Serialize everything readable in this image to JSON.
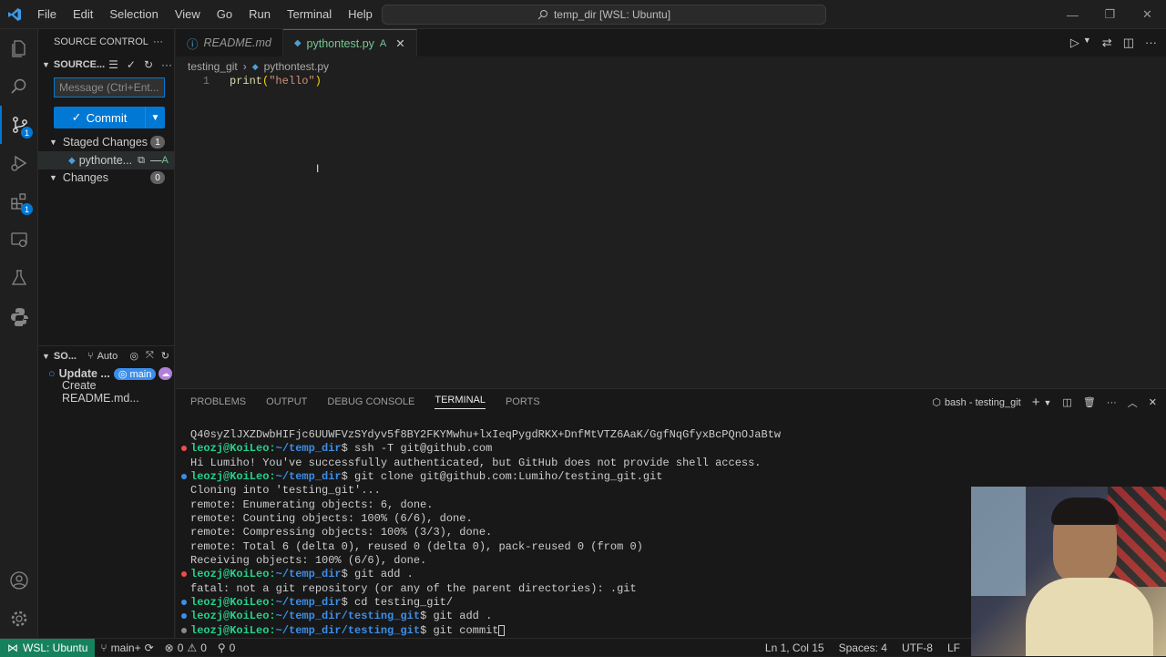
{
  "titlebar": {
    "menu": [
      "File",
      "Edit",
      "Selection",
      "View",
      "Go",
      "Run",
      "Terminal",
      "Help"
    ],
    "search": "temp_dir [WSL: Ubuntu]"
  },
  "activity": {
    "scm_badge": "1",
    "ext_badge": "1"
  },
  "sidebar": {
    "title": "SOURCE CONTROL",
    "section": "SOURCE...",
    "message_placeholder": "Message (Ctrl+Ent...",
    "commit_label": "Commit",
    "staged": {
      "label": "Staged Changes",
      "count": "1",
      "file": "pythonte...",
      "status": "A"
    },
    "changes": {
      "label": "Changes",
      "count": "0"
    },
    "graph": {
      "label": "SO...",
      "auto": "Auto",
      "items": [
        {
          "text": "Update ...",
          "branch": "main"
        },
        {
          "text": "Create README.md..."
        }
      ]
    }
  },
  "editor": {
    "tabs": [
      {
        "label": "README.md"
      },
      {
        "label": "pythontest.py",
        "status": "A"
      }
    ],
    "breadcrumb": [
      "testing_git",
      "pythontest.py"
    ],
    "lines": [
      {
        "num": "1",
        "code": "print(\"hello\")"
      }
    ]
  },
  "panel": {
    "tabs": [
      "PROBLEMS",
      "OUTPUT",
      "DEBUG CONSOLE",
      "TERMINAL",
      "PORTS"
    ],
    "terminal_name": "bash - testing_git"
  },
  "terminal": [
    {
      "type": "out",
      "text": "Q40syZlJXZDwbHIFjc6UUWFVzSYdyv5f8BY2FKYMwhu+lxIeqPygdRKX+DnfMtVTZ6AaK/GgfNqGfyxBcPQnOJaBtw"
    },
    {
      "type": "cmd",
      "dot": "#f14c4c",
      "user": "leozj@KoiLeo",
      "path": "~/temp_dir",
      "cmd": "ssh -T git@github.com"
    },
    {
      "type": "out",
      "text": "Hi Lumiho! You've successfully authenticated, but GitHub does not provide shell access."
    },
    {
      "type": "cmd",
      "dot": "#3b8eea",
      "user": "leozj@KoiLeo",
      "path": "~/temp_dir",
      "cmd": "git clone git@github.com:Lumiho/testing_git.git"
    },
    {
      "type": "out",
      "text": "Cloning into 'testing_git'..."
    },
    {
      "type": "out",
      "text": "remote: Enumerating objects: 6, done."
    },
    {
      "type": "out",
      "text": "remote: Counting objects: 100% (6/6), done."
    },
    {
      "type": "out",
      "text": "remote: Compressing objects: 100% (3/3), done."
    },
    {
      "type": "out",
      "text": "remote: Total 6 (delta 0), reused 0 (delta 0), pack-reused 0 (from 0)"
    },
    {
      "type": "out",
      "text": "Receiving objects: 100% (6/6), done."
    },
    {
      "type": "cmd",
      "dot": "#f14c4c",
      "user": "leozj@KoiLeo",
      "path": "~/temp_dir",
      "cmd": "git add ."
    },
    {
      "type": "out",
      "text": "fatal: not a git repository (or any of the parent directories): .git"
    },
    {
      "type": "cmd",
      "dot": "#3b8eea",
      "user": "leozj@KoiLeo",
      "path": "~/temp_dir",
      "cmd": "cd testing_git/"
    },
    {
      "type": "cmd",
      "dot": "#3b8eea",
      "user": "leozj@KoiLeo",
      "path": "~/temp_dir/testing_git",
      "cmd": "git add ."
    },
    {
      "type": "cmd",
      "dot": "#8b8b8b",
      "user": "leozj@KoiLeo",
      "path": "~/temp_dir/testing_git",
      "cmd": "git commit"
    }
  ],
  "statusbar": {
    "remote": "WSL: Ubuntu",
    "branch": "main+",
    "errors": "0",
    "warnings": "0",
    "ports": "0",
    "position": "Ln 1, Col 15",
    "spaces": "Spaces: 4",
    "encoding": "UTF-8",
    "eol": "LF"
  },
  "colors": {
    "accent": "#0078d4",
    "remote": "#16825d",
    "added": "#73c991"
  }
}
